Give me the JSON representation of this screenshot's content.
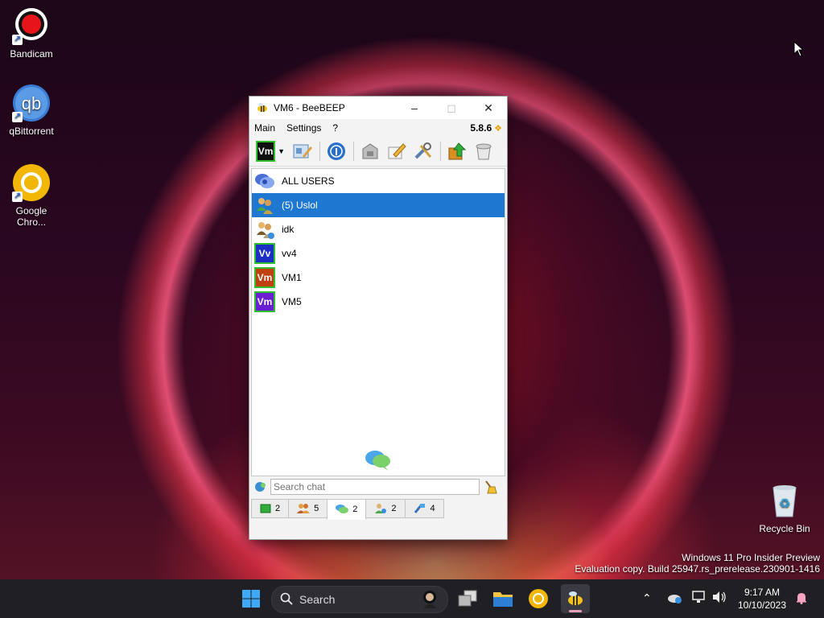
{
  "desktop": {
    "icons": [
      {
        "label": "Bandicam",
        "icon": "bandicam-icon"
      },
      {
        "label": "qBittorrent",
        "icon": "qbittorrent-icon"
      },
      {
        "label": "Google Chro...",
        "icon": "chrome-icon"
      },
      {
        "label": "Recycle Bin",
        "icon": "recycle-bin-icon"
      }
    ],
    "watermark": {
      "line1": "Windows 11 Pro Insider Preview",
      "line2": "Evaluation copy. Build 25947.rs_prerelease.230901-1416"
    }
  },
  "window": {
    "title": "VM6 - BeeBEEP",
    "menu": [
      "Main",
      "Settings",
      "?"
    ],
    "version": "5.8.6",
    "toolbar_avatar": "Vm",
    "users": [
      {
        "name": "ALL USERS",
        "avatar": "all-users-chat-icon"
      },
      {
        "name": "(5) Uslol",
        "avatar": "group-icon",
        "selected": true
      },
      {
        "name": "idk",
        "avatar": "group-icon"
      },
      {
        "name": "vv4",
        "initials": "Vv",
        "color": "#1b2fc4"
      },
      {
        "name": "VM1",
        "initials": "Vm",
        "color": "#c04010"
      },
      {
        "name": "VM5",
        "initials": "Vm",
        "color": "#6a1fd0"
      }
    ],
    "search": {
      "placeholder": "Search chat"
    },
    "tabs": [
      {
        "icon": "users-online-icon",
        "count": "2"
      },
      {
        "icon": "groups-icon",
        "count": "5"
      },
      {
        "icon": "chats-icon",
        "count": "2",
        "active": true
      },
      {
        "icon": "shared-groups-icon",
        "count": "2"
      },
      {
        "icon": "network-icon",
        "count": "4"
      }
    ]
  },
  "taskbar": {
    "search_label": "Search",
    "time": "9:17 AM",
    "date": "10/10/2023"
  }
}
